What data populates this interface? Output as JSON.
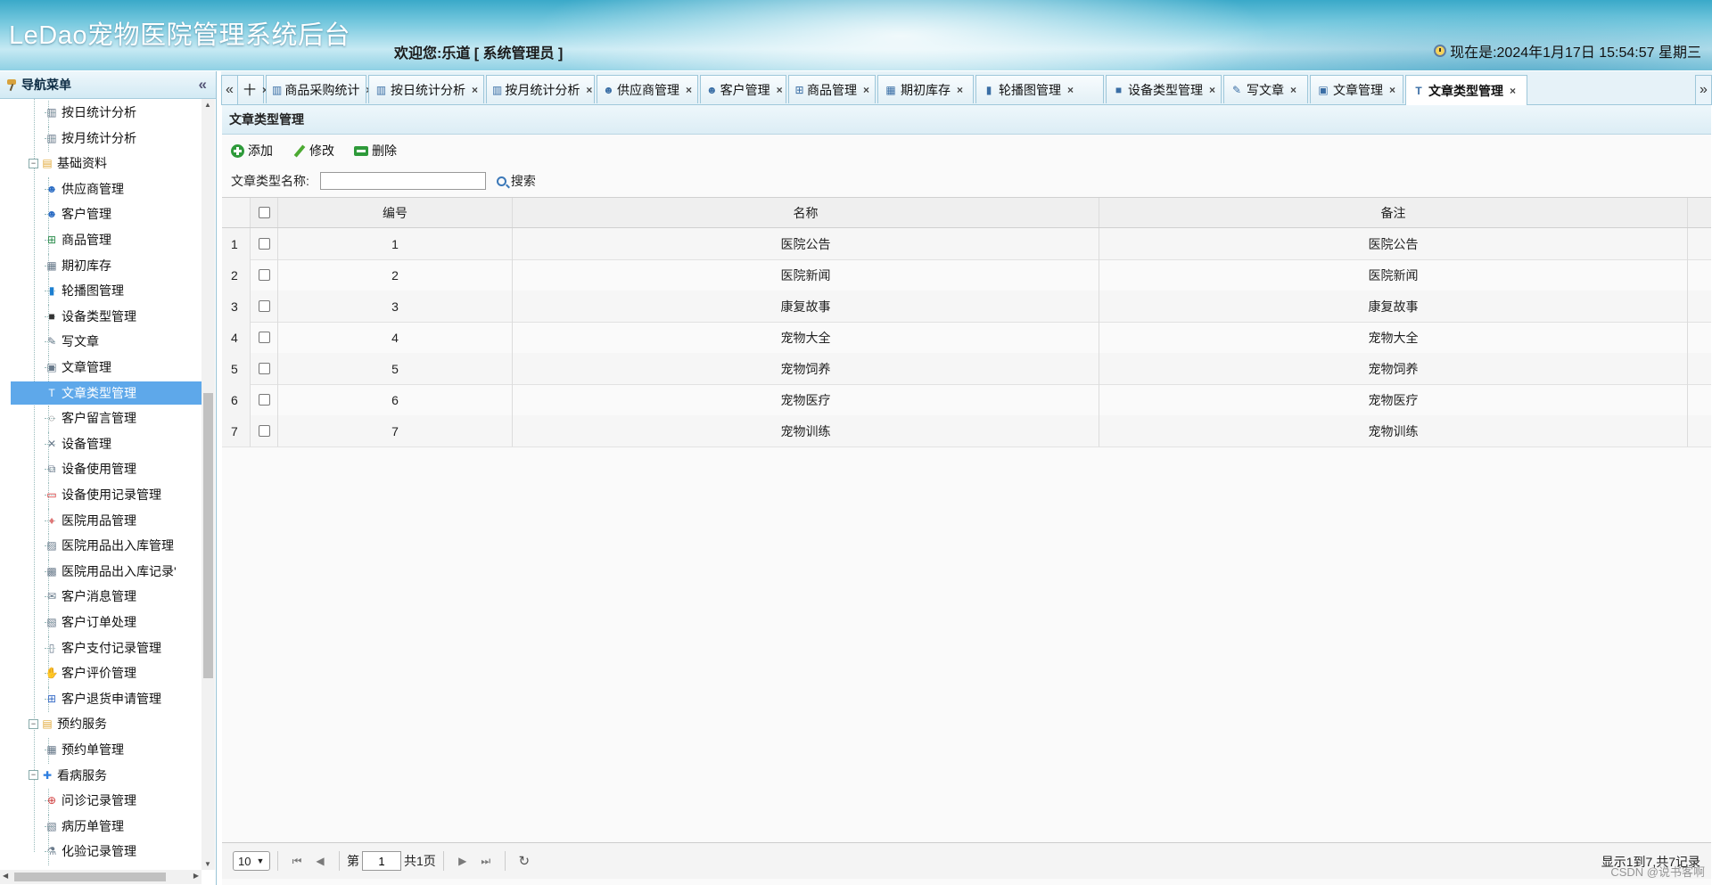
{
  "header": {
    "app_title": "LeDao宠物医院管理系统后台",
    "welcome": "欢迎您:乐道 [ 系统管理员 ]",
    "clock": "现在是:2024年1月17日 15:54:57 星期三"
  },
  "nav": {
    "title": "导航菜单",
    "collapse_icon": "«",
    "items": [
      {
        "label": "按日统计分析",
        "icon": "chart-icon"
      },
      {
        "label": "按月统计分析",
        "icon": "chart-icon"
      },
      {
        "label": "基础资料",
        "icon": "folder-icon"
      },
      {
        "label": "供应商管理",
        "icon": "user-icon"
      },
      {
        "label": "客户管理",
        "icon": "user-icon"
      },
      {
        "label": "商品管理",
        "icon": "sitemap-icon"
      },
      {
        "label": "期初库存",
        "icon": "box-icon"
      },
      {
        "label": "轮播图管理",
        "icon": "slides-icon"
      },
      {
        "label": "设备类型管理",
        "icon": "chip-icon"
      },
      {
        "label": "写文章",
        "icon": "pen-icon"
      },
      {
        "label": "文章管理",
        "icon": "document-icon"
      },
      {
        "label": "文章类型管理",
        "icon": "text-type-icon"
      },
      {
        "label": "客户留言管理",
        "icon": "comment-icon"
      },
      {
        "label": "设备管理",
        "icon": "tools-icon"
      },
      {
        "label": "设备使用管理",
        "icon": "device-use-icon"
      },
      {
        "label": "设备使用记录管理",
        "icon": "monitor-icon"
      },
      {
        "label": "医院用品管理",
        "icon": "bottle-icon"
      },
      {
        "label": "医院用品出入库管理",
        "icon": "warehouse-icon"
      },
      {
        "label": "医院用品出入库记录'",
        "icon": "store-icon"
      },
      {
        "label": "客户消息管理",
        "icon": "message-icon"
      },
      {
        "label": "客户订单处理",
        "icon": "clipboard-icon"
      },
      {
        "label": "客户支付记录管理",
        "icon": "receipt-icon"
      },
      {
        "label": "客户评价管理",
        "icon": "thumbs-up-icon"
      },
      {
        "label": "客户退货申请管理",
        "icon": "grid-icon"
      },
      {
        "label": "预约服务",
        "icon": "folder-icon"
      },
      {
        "label": "预约单管理",
        "icon": "calendar-icon"
      },
      {
        "label": "看病服务",
        "icon": "medical-icon"
      },
      {
        "label": "问诊记录管理",
        "icon": "cross-icon"
      },
      {
        "label": "病历单管理",
        "icon": "clipboard-icon"
      },
      {
        "label": "化验记录管理",
        "icon": "flask-icon"
      }
    ]
  },
  "tabs": [
    {
      "label": "十"
    },
    {
      "label": "商品采购统计"
    },
    {
      "label": "按日统计分析"
    },
    {
      "label": "按月统计分析"
    },
    {
      "label": "供应商管理"
    },
    {
      "label": "客户管理"
    },
    {
      "label": "商品管理"
    },
    {
      "label": "期初库存"
    },
    {
      "label": "轮播图管理"
    },
    {
      "label": "设备类型管理"
    },
    {
      "label": "写文章"
    },
    {
      "label": "文章管理"
    },
    {
      "label": "文章类型管理"
    }
  ],
  "tab_close": "×",
  "tab_scroll_left": "«",
  "tab_scroll_right": "»",
  "panel": {
    "title": "文章类型管理",
    "toolbar": {
      "add": "添加",
      "edit": "修改",
      "delete": "删除"
    },
    "search": {
      "label": "文章类型名称:",
      "value": "",
      "button": "搜索"
    }
  },
  "grid": {
    "columns": [
      "编号",
      "名称",
      "备注"
    ],
    "rows": [
      {
        "n": "1",
        "id": "1",
        "name": "医院公告",
        "remark": "医院公告"
      },
      {
        "n": "2",
        "id": "2",
        "name": "医院新闻",
        "remark": "医院新闻"
      },
      {
        "n": "3",
        "id": "3",
        "name": "康复故事",
        "remark": "康复故事"
      },
      {
        "n": "4",
        "id": "4",
        "name": "宠物大全",
        "remark": "宠物大全"
      },
      {
        "n": "5",
        "id": "5",
        "name": "宠物饲养",
        "remark": "宠物饲养"
      },
      {
        "n": "6",
        "id": "6",
        "name": "宠物医疗",
        "remark": "宠物医疗"
      },
      {
        "n": "7",
        "id": "7",
        "name": "宠物训练",
        "remark": "宠物训练"
      }
    ]
  },
  "pager": {
    "page_size": "10",
    "page_prefix": "第",
    "page_value": "1",
    "page_suffix": "共1页",
    "info": "显示1到7,共7记录"
  },
  "watermark": "CSDN @说书客啊"
}
